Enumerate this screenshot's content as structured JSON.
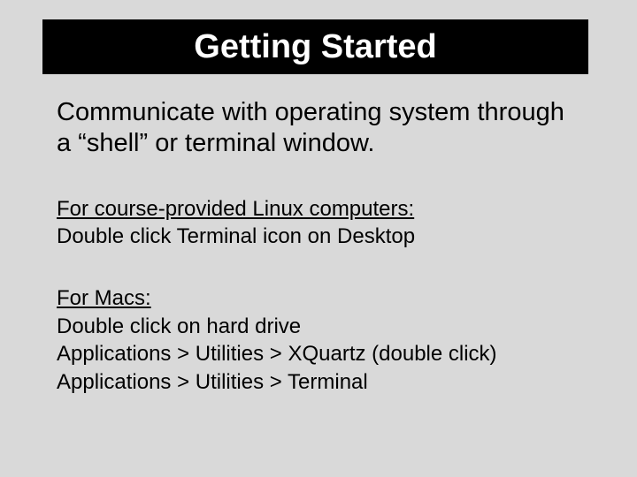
{
  "title": "Getting Started",
  "lead": "Communicate with operating system through a “shell” or terminal window.",
  "linux": {
    "heading": "For course-provided Linux computers:",
    "line1": "Double click Terminal icon on Desktop"
  },
  "mac": {
    "heading": "For Macs:",
    "line1": "Double click on hard drive",
    "line2": "Applications > Utilities > XQuartz (double click)",
    "line3": "Applications > Utilities > Terminal"
  }
}
